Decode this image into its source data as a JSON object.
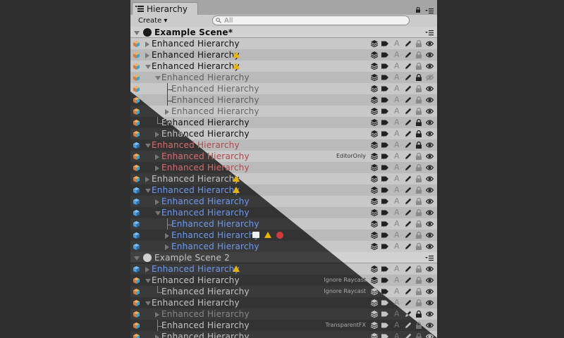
{
  "window": {
    "tab_label": "Hierarchy",
    "create_label": "Create",
    "search_placeholder": "All"
  },
  "rows": [
    {
      "kind": "scene",
      "name": "Example Scene*",
      "expanded": true
    },
    {
      "kind": "go",
      "name": "Enhanced Hierarchy",
      "depth": 0,
      "fold": "closed",
      "tree": "none",
      "warn": false,
      "lock": false,
      "eye_off": false
    },
    {
      "kind": "go",
      "name": "Enhanced Hierarchy",
      "depth": 0,
      "fold": "closed",
      "tree": "none",
      "warn": true,
      "lock": false,
      "eye_off": false
    },
    {
      "kind": "go",
      "name": "Enhanced Hierarchy",
      "depth": 0,
      "fold": "open",
      "tree": "none",
      "warn": true,
      "lock": false,
      "eye_off": false
    },
    {
      "kind": "go",
      "name": "Enhanced Hierarchy",
      "depth": 1,
      "fold": "open",
      "tree": "none",
      "dim": true,
      "lock": true,
      "eye_off": true
    },
    {
      "kind": "go",
      "name": "Enhanced Hierarchy",
      "depth": 2,
      "fold": "none",
      "tree": "branch",
      "dim": true,
      "lock": false,
      "eye_off": false
    },
    {
      "kind": "go",
      "name": "Enhanced Hierarchy",
      "depth": 2,
      "fold": "none",
      "tree": "branch",
      "dim": true,
      "lock": false,
      "eye_off": false
    },
    {
      "kind": "go",
      "name": "Enhanced Hierarchy",
      "depth": 2,
      "fold": "closed",
      "tree": "none",
      "dim": true,
      "lock": false,
      "eye_off": false
    },
    {
      "kind": "go",
      "name": "Enhanced Hierarchy",
      "depth": 1,
      "fold": "none",
      "tree": "last",
      "lock": true,
      "eye_off": false
    },
    {
      "kind": "go",
      "name": "Enhanced Hierarchy",
      "depth": 1,
      "fold": "closed",
      "tree": "none",
      "lock": true,
      "eye_off": false
    },
    {
      "kind": "go",
      "name": "Enhanced Hierarchy",
      "depth": 0,
      "fold": "open",
      "tree": "none",
      "style": "red",
      "cube": "blue",
      "lock": true,
      "eye_off": false
    },
    {
      "kind": "go",
      "name": "Enhanced Hierarchy",
      "depth": 1,
      "fold": "closed",
      "tree": "none",
      "style": "red",
      "tag": "EditorOnly",
      "lock": false,
      "eye_off": false
    },
    {
      "kind": "go",
      "name": "Enhanced Hierarchy",
      "depth": 1,
      "fold": "closed",
      "tree": "none",
      "style": "red",
      "lock": false,
      "eye_off": false
    },
    {
      "kind": "go",
      "name": "Enhanced Hierarchy",
      "depth": 0,
      "fold": "closed",
      "tree": "none",
      "warn": true,
      "lock": false,
      "eye_off": false
    },
    {
      "kind": "go",
      "name": "Enhanced Hierarchy",
      "depth": 0,
      "fold": "open",
      "tree": "none",
      "style": "blue",
      "cube": "blue",
      "warn": true,
      "lock": false,
      "eye_off": false
    },
    {
      "kind": "go",
      "name": "Enhanced Hierarchy",
      "depth": 1,
      "fold": "closed",
      "tree": "none",
      "style": "blue",
      "cube": "blue",
      "lock": false,
      "eye_off": false
    },
    {
      "kind": "go",
      "name": "Enhanced Hierarchy",
      "depth": 1,
      "fold": "open",
      "tree": "none",
      "style": "blue",
      "cube": "blue",
      "lock": false,
      "eye_off": false
    },
    {
      "kind": "go",
      "name": "Enhanced Hierarchy",
      "depth": 2,
      "fold": "none",
      "tree": "branch",
      "style": "blue",
      "cube": "blue",
      "lock": false,
      "eye_off": false
    },
    {
      "kind": "go",
      "name": "Enhanced Hierarchy",
      "depth": 2,
      "fold": "closed",
      "tree": "none",
      "style": "blue",
      "cube": "blue",
      "note": true,
      "warn": true,
      "err": true,
      "lock": false,
      "eye_off": false
    },
    {
      "kind": "go",
      "name": "Enhanced Hierarchy",
      "depth": 2,
      "fold": "closed",
      "tree": "none",
      "style": "blue",
      "cube": "blue",
      "lock": false,
      "eye_off": false
    },
    {
      "kind": "scene",
      "name": "Example Scene 2",
      "expanded": true
    },
    {
      "kind": "go",
      "name": "Enhanced Hierarchy",
      "depth": 0,
      "fold": "closed",
      "tree": "none",
      "style": "blue",
      "cube": "blue",
      "warn": true,
      "lock": false,
      "eye_off": false
    },
    {
      "kind": "go",
      "name": "Enhanced Hierarchy",
      "depth": 0,
      "fold": "open",
      "tree": "none",
      "tag": "Ignore Raycast",
      "lock": false,
      "eye_off": false
    },
    {
      "kind": "go",
      "name": "Enhanced Hierarchy",
      "depth": 1,
      "fold": "none",
      "tree": "last",
      "tag": "Ignore Raycast",
      "lock": false,
      "eye_off": false
    },
    {
      "kind": "go",
      "name": "Enhanced Hierarchy",
      "depth": 0,
      "fold": "open",
      "tree": "none",
      "lock": false,
      "eye_off": false
    },
    {
      "kind": "go",
      "name": "Enhanced Hierarchy",
      "depth": 1,
      "fold": "closed",
      "tree": "none",
      "dim": true,
      "lock": true,
      "eye_off": false
    },
    {
      "kind": "go",
      "name": "Enhanced Hierarchy",
      "depth": 1,
      "fold": "none",
      "tree": "branch",
      "tag": "TransparentFX",
      "lock": false,
      "eye_off": false
    },
    {
      "kind": "go",
      "name": "Enhanced Hierarchy",
      "depth": 1,
      "fold": "closed",
      "tree": "none",
      "lock": false,
      "eye_off": false
    }
  ],
  "icons": {
    "layer": "layers-icon",
    "tag": "tag-icon",
    "static": "static-icon",
    "edit": "pencil-icon",
    "lock": "lock-icon",
    "eye": "eye-icon"
  },
  "colors": {
    "warning": "#e6b400",
    "error": "#d13b3b",
    "prefab_blue": "#3d6ad1",
    "missing_red": "#a94a4a"
  }
}
